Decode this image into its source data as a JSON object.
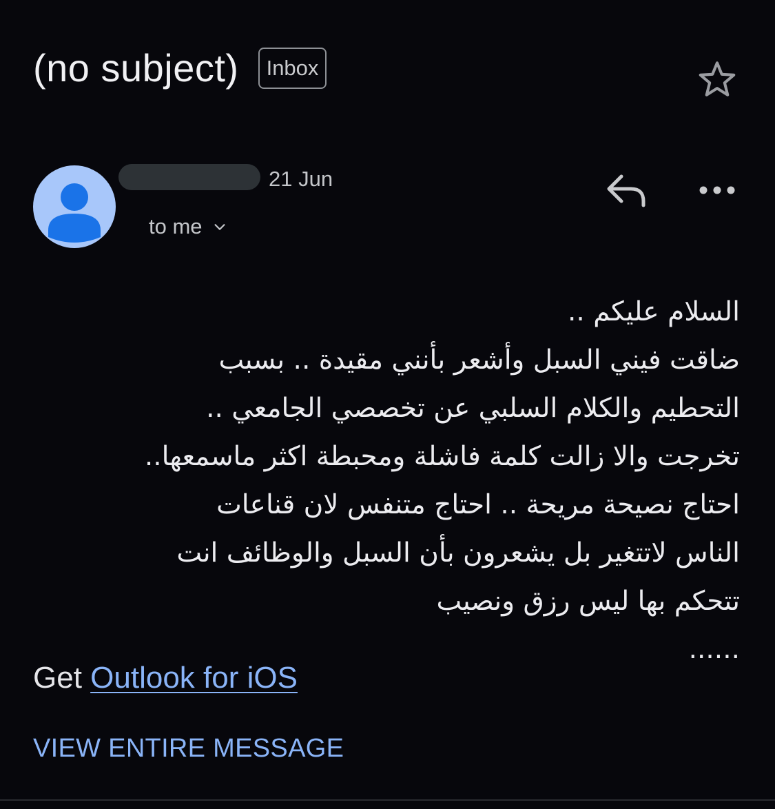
{
  "header": {
    "subject": "(no subject)",
    "label": "Inbox",
    "star_icon": "star-outline-icon"
  },
  "message": {
    "avatar_icon": "person-avatar-icon",
    "date": "21 Jun",
    "recipients": "to me",
    "recipients_toggle_icon": "chevron-down-icon",
    "reply_icon": "reply-icon",
    "more_icon": "more-horizontal-icon",
    "body_lines": [
      "السلام عليكم ..",
      "ضاقت فيني السبل وأشعر بأنني مقيدة .. بسبب",
      "التحطيم والكلام السلبي عن تخصصي الجامعي ..",
      "تخرجت والا زالت كلمة فاشلة ومحبطة اكثر ماسمعها..",
      "احتاج نصيحة مريحة .. احتاج متنفس لان قناعات",
      "الناس لاتتغير بل يشعرون بأن السبل والوظائف انت",
      "تتحكم بها ليس رزق ونصيب",
      "......"
    ],
    "signature_prefix": "Get",
    "signature_link": "Outlook for iOS",
    "view_entire": "VIEW ENTIRE MESSAGE"
  },
  "colors": {
    "background": "#07070c",
    "accent_link": "#8ab4f8",
    "avatar_bg": "#a8c7fa",
    "avatar_fg": "#1a73e8"
  }
}
